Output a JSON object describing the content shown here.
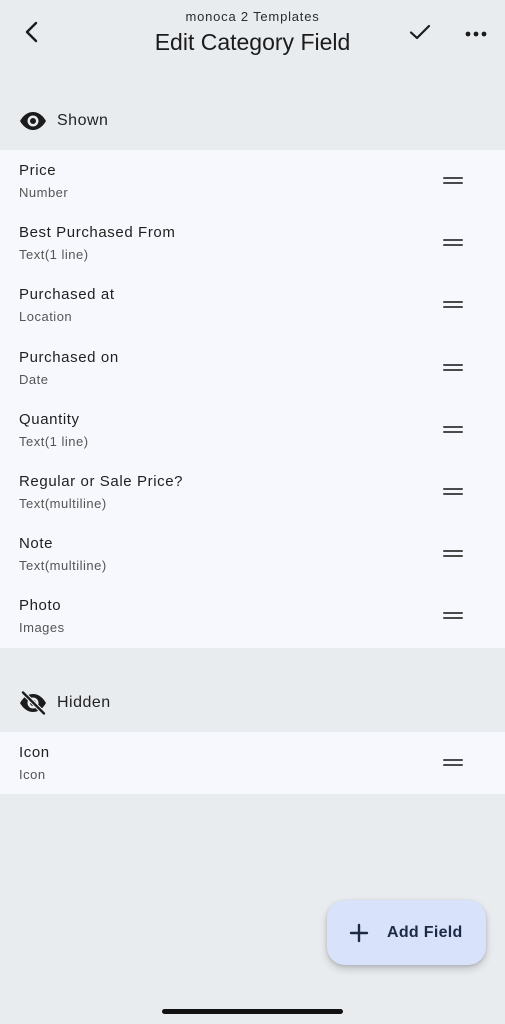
{
  "header": {
    "subtitle": "monoca 2 Templates",
    "title": "Edit Category Field",
    "back_icon": "chevron-left-icon",
    "confirm_icon": "check-icon",
    "more_icon": "more-horizontal-icon"
  },
  "shown_section": {
    "label": "Shown",
    "icon": "eye-icon",
    "fields": [
      {
        "name": "Price",
        "type": "Number"
      },
      {
        "name": "Best Purchased From",
        "type": "Text(1 line)"
      },
      {
        "name": "Purchased at",
        "type": "Location"
      },
      {
        "name": "Purchased on",
        "type": "Date"
      },
      {
        "name": "Quantity",
        "type": "Text(1 line)"
      },
      {
        "name": "Regular or Sale Price?",
        "type": "Text(multiline)"
      },
      {
        "name": "Note",
        "type": "Text(multiline)"
      },
      {
        "name": "Photo",
        "type": "Images"
      }
    ]
  },
  "hidden_section": {
    "label": "Hidden",
    "icon": "eye-off-icon",
    "fields": [
      {
        "name": "Icon",
        "type": "Icon"
      }
    ]
  },
  "fab": {
    "label": "Add Field",
    "icon": "plus-icon"
  },
  "colors": {
    "background": "#e9ecef",
    "list_background": "#f7f8fd",
    "fab_background": "#d9e2fb",
    "fab_text": "#1b2b44"
  }
}
